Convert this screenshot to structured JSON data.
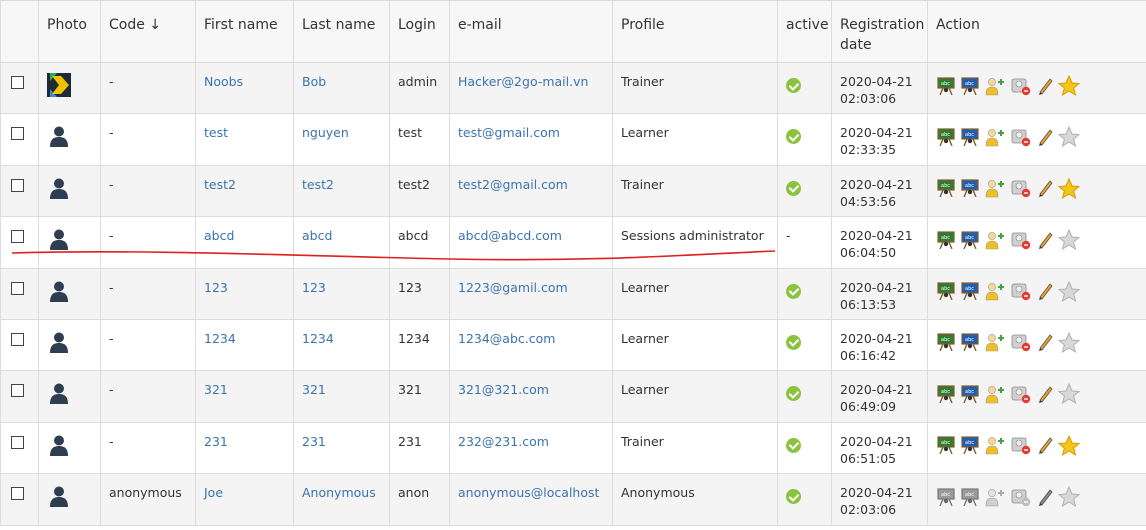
{
  "headers": {
    "photo": "Photo",
    "code": "Code ↓",
    "first_name": "First name",
    "last_name": "Last name",
    "login": "Login",
    "email": "e-mail",
    "profile": "Profile",
    "active": "active",
    "registration_date": "Registration date",
    "action": "Action"
  },
  "colors": {
    "link": "#3b73ad",
    "active_ok": "#8ac43f",
    "annotation": "#e02020",
    "star": "#f5c518"
  },
  "rows": [
    {
      "photo": "logo",
      "code": "-",
      "first_name": "Noobs",
      "last_name": "Bob",
      "login": "admin",
      "email": "Hacker@2go-mail.vn",
      "profile": "Trainer",
      "active": "check",
      "reg_date": "2020-04-21",
      "reg_time": "02:03:06",
      "actions_enabled": true,
      "star_active": true
    },
    {
      "photo": "user",
      "code": "-",
      "first_name": "test",
      "last_name": "nguyen",
      "login": "test",
      "email": "test@gmail.com",
      "profile": "Learner",
      "active": "check",
      "reg_date": "2020-04-21",
      "reg_time": "02:33:35",
      "actions_enabled": true,
      "star_active": false
    },
    {
      "photo": "user",
      "code": "-",
      "first_name": "test2",
      "last_name": "test2",
      "login": "test2",
      "email": "test2@gmail.com",
      "profile": "Trainer",
      "active": "check",
      "reg_date": "2020-04-21",
      "reg_time": "04:53:56",
      "actions_enabled": true,
      "star_active": true
    },
    {
      "photo": "user",
      "code": "-",
      "first_name": "abcd",
      "last_name": "abcd",
      "login": "abcd",
      "email": "abcd@abcd.com",
      "profile": "Sessions administrator",
      "active": "-",
      "reg_date": "2020-04-21",
      "reg_time": "06:04:50",
      "actions_enabled": true,
      "star_active": false
    },
    {
      "photo": "user",
      "code": "-",
      "first_name": "123",
      "last_name": "123",
      "login": "123",
      "email": "1223@gamil.com",
      "profile": "Learner",
      "active": "check",
      "reg_date": "2020-04-21",
      "reg_time": "06:13:53",
      "actions_enabled": true,
      "star_active": false
    },
    {
      "photo": "user",
      "code": "-",
      "first_name": "1234",
      "last_name": "1234",
      "login": "1234",
      "email": "1234@abc.com",
      "profile": "Learner",
      "active": "check",
      "reg_date": "2020-04-21",
      "reg_time": "06:16:42",
      "actions_enabled": true,
      "star_active": false
    },
    {
      "photo": "user",
      "code": "-",
      "first_name": "321",
      "last_name": "321",
      "login": "321",
      "email": "321@321.com",
      "profile": "Learner",
      "active": "check",
      "reg_date": "2020-04-21",
      "reg_time": "06:49:09",
      "actions_enabled": true,
      "star_active": false
    },
    {
      "photo": "user",
      "code": "-",
      "first_name": "231",
      "last_name": "231",
      "login": "231",
      "email": "232@231.com",
      "profile": "Trainer",
      "active": "check",
      "reg_date": "2020-04-21",
      "reg_time": "06:51:05",
      "actions_enabled": true,
      "star_active": true
    },
    {
      "photo": "user",
      "code": "anonymous",
      "first_name": "Joe",
      "last_name": "Anonymous",
      "login": "anon",
      "email": "anonymous@localhost",
      "profile": "Anonymous",
      "active": "check",
      "reg_date": "2020-04-21",
      "reg_time": "02:03:06",
      "actions_enabled": false,
      "star_active": false
    }
  ]
}
